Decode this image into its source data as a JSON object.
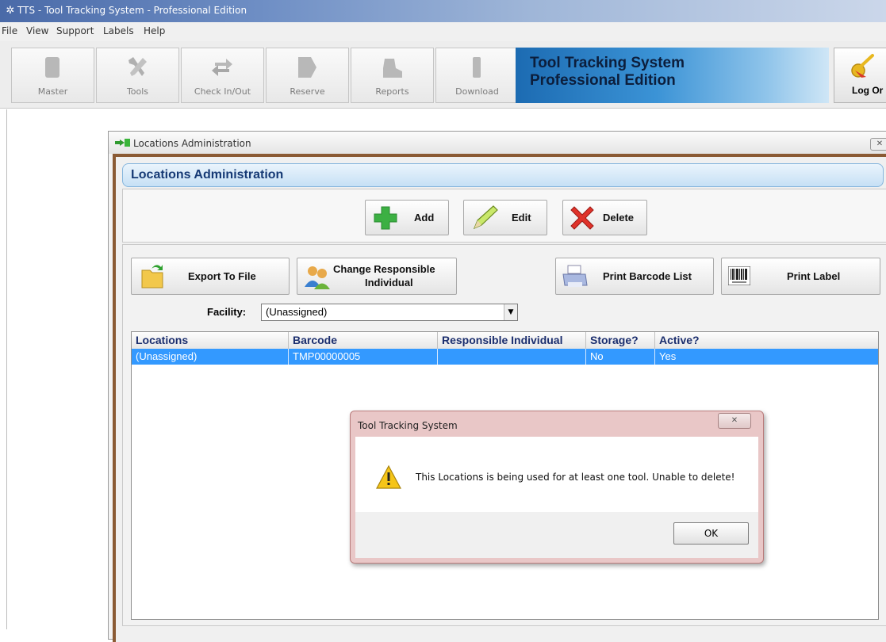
{
  "window": {
    "title": "TTS - Tool Tracking System - Professional Edition"
  },
  "menu": [
    "File",
    "View",
    "Support",
    "Labels",
    "Help"
  ],
  "toolbar": {
    "buttons": [
      "Master",
      "Tools",
      "Check In/Out",
      "Reserve",
      "Reports",
      "Download"
    ],
    "banner_line1": "Tool Tracking System",
    "banner_line2": "Professional Edition",
    "logout_label": "Log Or"
  },
  "child_window": {
    "title": "Locations Administration",
    "close_glyph": "✕",
    "header": "Locations Administration",
    "buttons": {
      "add": "Add",
      "edit": "Edit",
      "delete": "Delete",
      "export": "Export To File",
      "change_responsible_1": "Change Responsible",
      "change_responsible_2": "Individual",
      "print_barcode": "Print Barcode List",
      "print_label": "Print Label"
    },
    "facility": {
      "label": "Facility:",
      "value": "(Unassigned)"
    },
    "grid": {
      "columns": [
        "Locations",
        "Barcode",
        "Responsible Individual",
        "Storage?",
        "Active?"
      ],
      "rows": [
        [
          "(Unassigned)",
          "TMP00000005",
          "",
          "No",
          "Yes"
        ]
      ]
    }
  },
  "dialog": {
    "title": "Tool Tracking System",
    "close_glyph": "✕",
    "message": "This Locations is being used for at least one tool.  Unable to delete!",
    "ok_label": "OK"
  }
}
